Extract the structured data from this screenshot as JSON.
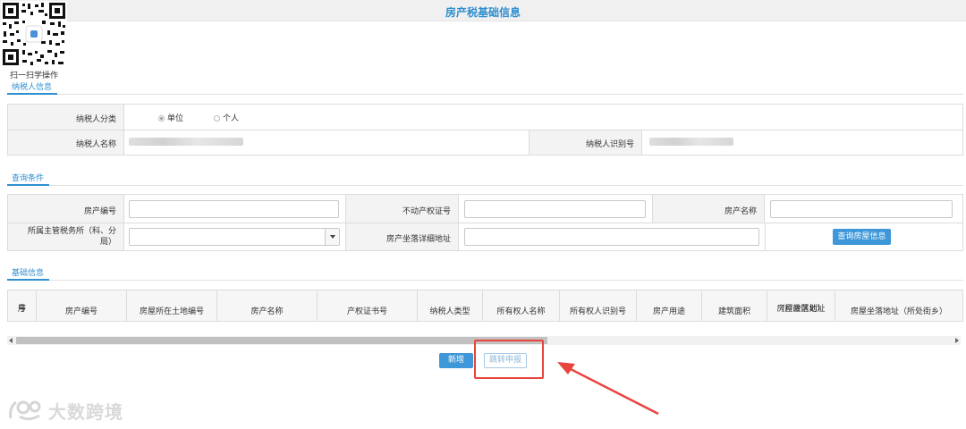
{
  "page": {
    "title": "房产税基础信息"
  },
  "qr": {
    "caption": "扫一扫学操作"
  },
  "taxpayer_section": {
    "tab_label": "纳税人信息",
    "category_label": "纳税人分类",
    "options": [
      {
        "label": "单位",
        "selected": true
      },
      {
        "label": "个人",
        "selected": false
      }
    ],
    "name_label": "纳税人名称",
    "id_label": "纳税人识别号"
  },
  "query_section": {
    "tab_label": "查询条件",
    "property_no_label": "房产编号",
    "cert_no_label": "不动产权证号",
    "property_name_label": "房产名称",
    "tax_office_label_line1": "所属主管税务所（科、分",
    "tax_office_label_line2": "局）",
    "address_label": "房产坐落详细地址",
    "query_button": "查询房屋信息"
  },
  "basic_section": {
    "tab_label": "基础信息",
    "columns": [
      {
        "line1": "序",
        "line2": "号"
      },
      {
        "line1": "",
        "line2": "房产编号"
      },
      {
        "line1": "",
        "line2": "房屋所在土地编号"
      },
      {
        "line1": "",
        "line2": "房产名称"
      },
      {
        "line1": "",
        "line2": "产权证书号"
      },
      {
        "line1": "",
        "line2": "纳税人类型"
      },
      {
        "line1": "",
        "line2": "所有权人名称"
      },
      {
        "line1": "",
        "line2": "所有权人识别号"
      },
      {
        "line1": "",
        "line2": "房产用途"
      },
      {
        "line1": "",
        "line2": "建筑面积"
      },
      {
        "line1": "房屋坐落地址",
        "line2": "（行政区划）"
      },
      {
        "line1": "",
        "line2": "房屋坐落地址（所处街乡）"
      }
    ]
  },
  "actions": {
    "add_button": "新增",
    "jump_button": "跳转申报"
  },
  "watermark": {
    "text": "大数跨境"
  },
  "colors": {
    "accent": "#3d97d8",
    "highlight": "#e8453c",
    "title": "#2f8fd0"
  }
}
